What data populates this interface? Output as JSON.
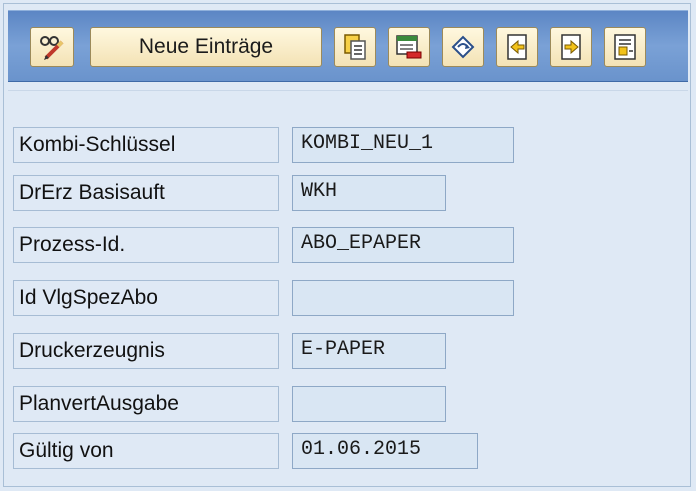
{
  "toolbar": {
    "new_entries_label": "Neue Einträge",
    "icons": [
      "edit-glasses-icon",
      "copy-icon",
      "delete-icon",
      "undo-icon",
      "previous-entry-icon",
      "next-entry-icon",
      "select-all-icon"
    ]
  },
  "form": {
    "fields": [
      {
        "label": "Kombi-Schlüssel",
        "value": "KOMBI_NEU_1"
      },
      {
        "label": "DrErz Basisauft",
        "value": "WKH"
      },
      {
        "label": "Prozess-Id.",
        "value": "ABO_EPAPER"
      },
      {
        "label": "Id VlgSpezAbo",
        "value": ""
      },
      {
        "label": "Druckerzeugnis",
        "value": "E-PAPER"
      },
      {
        "label": "PlanvertAusgabe",
        "value": ""
      },
      {
        "label": "Gültig von",
        "value": "01.06.2015"
      }
    ]
  }
}
